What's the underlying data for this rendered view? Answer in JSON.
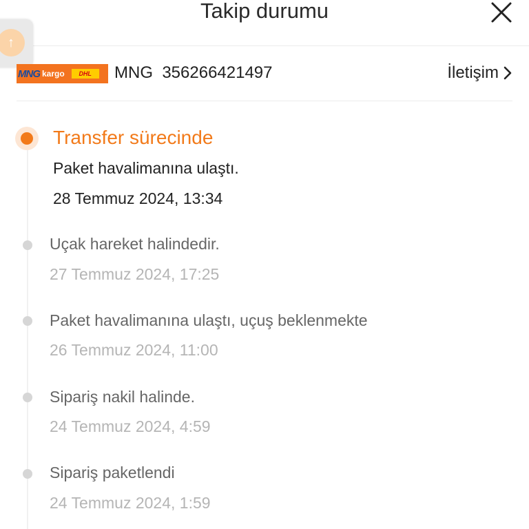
{
  "header": {
    "title": "Takip durumu"
  },
  "carrier": {
    "logo_mng": "MNG",
    "logo_kargo": "kargo",
    "logo_dhl": "DHL",
    "tracking_label": "MNG  356266421497",
    "contact_label": "İletişim"
  },
  "current_event": {
    "status": "Transfer sürecinde",
    "description": "Paket havalimanına ulaştı.",
    "time": "28 Temmuz 2024, 13:34"
  },
  "events": [
    {
      "description": "Uçak hareket halindedir.",
      "time": "27 Temmuz 2024, 17:25"
    },
    {
      "description": "Paket havalimanına ulaştı, uçuş beklenmekte",
      "time": "26 Temmuz 2024, 11:00"
    },
    {
      "description": "Sipariş nakil halinde.",
      "time": "24 Temmuz 2024, 4:59"
    },
    {
      "description": "Sipariş paketlendi",
      "time": "24 Temmuz 2024, 1:59"
    }
  ],
  "colors": {
    "accent": "#f27a1a",
    "muted": "#b5b5b5"
  }
}
